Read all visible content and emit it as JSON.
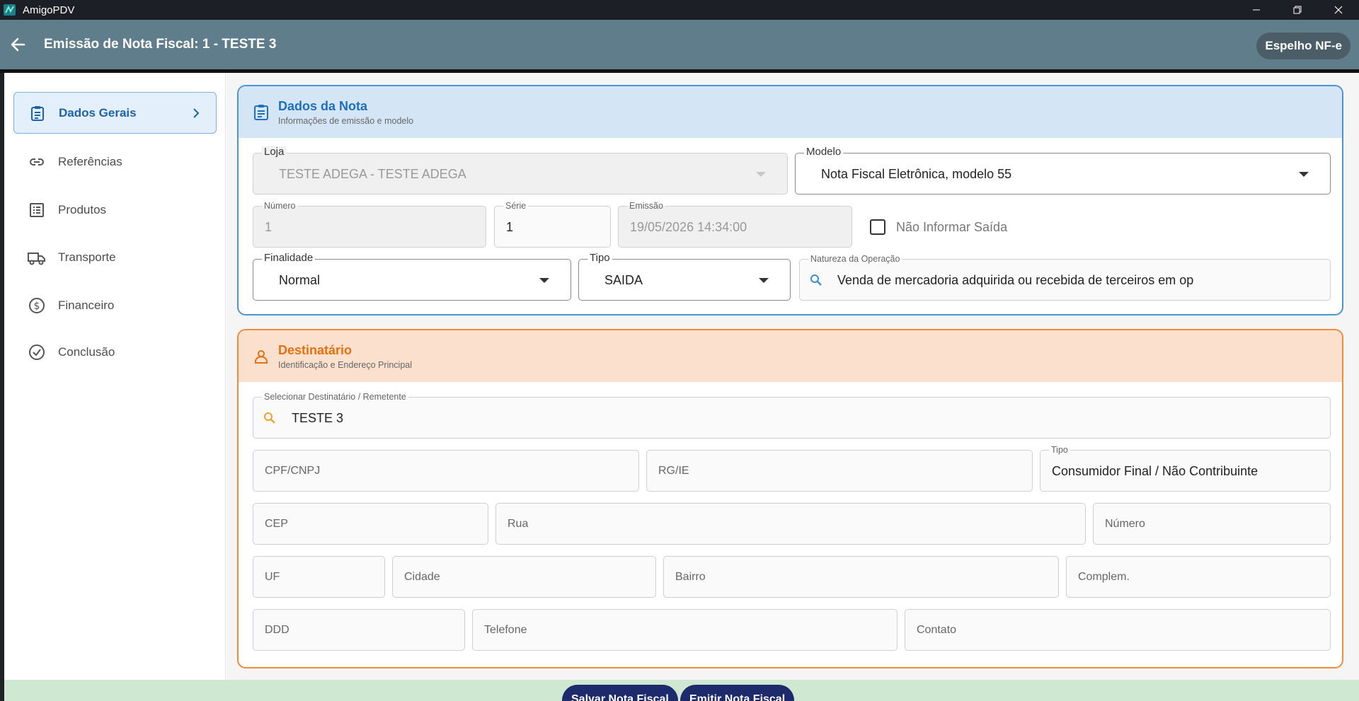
{
  "window": {
    "title": "AmigoPDV",
    "minimize": "—",
    "restore": "❐",
    "close": "✕"
  },
  "appbar": {
    "title": "Emissão de Nota Fiscal: 1 - TESTE 3",
    "espelho_label": "Espelho NF-e"
  },
  "sidebar": {
    "items": [
      {
        "label": "Dados Gerais",
        "icon": "clipboard-icon",
        "active": true
      },
      {
        "label": "Referências",
        "icon": "link-icon"
      },
      {
        "label": "Produtos",
        "icon": "list-icon"
      },
      {
        "label": "Transporte",
        "icon": "truck-icon"
      },
      {
        "label": "Financeiro",
        "icon": "dollar-circle-icon"
      },
      {
        "label": "Conclusão",
        "icon": "check-circle-icon"
      }
    ]
  },
  "nota": {
    "title": "Dados da Nota",
    "subtitle": "Informações de emissão e modelo",
    "loja": {
      "label": "Loja",
      "value": "TESTE ADEGA - TESTE ADEGA"
    },
    "modelo": {
      "label": "Modelo",
      "value": "Nota Fiscal Eletrônica, modelo 55"
    },
    "numero": {
      "label": "Número",
      "value": "1"
    },
    "serie": {
      "label": "Série",
      "value": "1"
    },
    "emissao": {
      "label": "Emissão",
      "value": "19/05/2026 14:34:00"
    },
    "nao_informar_saida": {
      "label": "Não Informar Saída",
      "checked": false
    },
    "finalidade": {
      "label": "Finalidade",
      "value": "Normal"
    },
    "tipo": {
      "label": "Tipo",
      "value": "SAIDA"
    },
    "natureza": {
      "label": "Natureza da Operação",
      "value": "Venda de mercadoria adquirida ou recebida de terceiros em op"
    }
  },
  "destinatario": {
    "title": "Destinatário",
    "subtitle": "Identificação e Endereço Principal",
    "selecionar": {
      "label": "Selecionar Destinatário / Remetente",
      "value": "TESTE 3"
    },
    "cpf_cnpj": "CPF/CNPJ",
    "rg_ie": "RG/IE",
    "tipo": {
      "label": "Tipo",
      "value": "Consumidor Final / Não Contribuinte"
    },
    "cep": "CEP",
    "rua": "Rua",
    "numero": "Número",
    "uf": "UF",
    "cidade": "Cidade",
    "bairro": "Bairro",
    "complemento": "Complem.",
    "ddd": "DDD",
    "telefone": "Telefone",
    "contato": "Contato"
  },
  "footer": {
    "salvar_label": "Salvar Nota Fiscal",
    "emitir_label": "Emitir Nota Fiscal"
  },
  "colors": {
    "appbar": "#607d8b",
    "accent_blue": "#1e6fbf",
    "accent_orange": "#e6700e",
    "footer_bg": "#cfe8d2",
    "button_bg": "#1d2a6b"
  }
}
